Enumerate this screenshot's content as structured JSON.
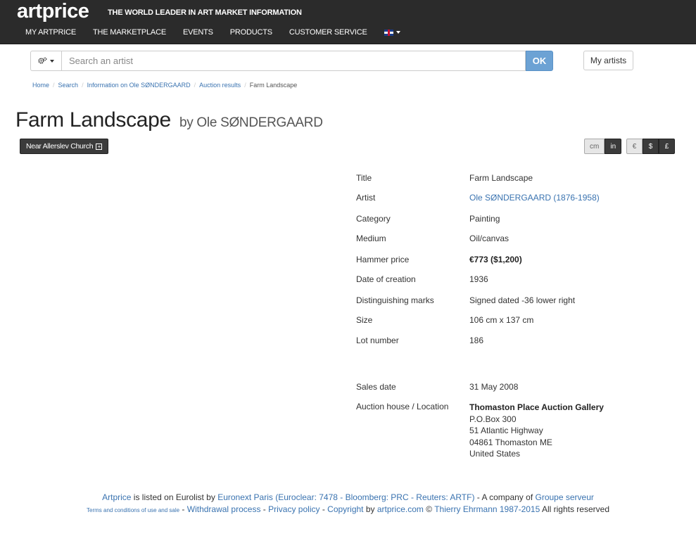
{
  "header": {
    "logo": "artprice",
    "logo_tm": "™",
    "tagline": "THE WORLD LEADER IN ART MARKET INFORMATION",
    "nav": [
      "MY ARTPRICE",
      "THE MARKETPLACE",
      "EVENTS",
      "PRODUCTS",
      "CUSTOMER SERVICE"
    ],
    "language_icon": "uk-flag-icon"
  },
  "search": {
    "placeholder": "Search an artist",
    "value": "",
    "ok_label": "OK",
    "settings_icon": "gears-icon",
    "my_artists_label": "My artists"
  },
  "breadcrumb": [
    "Home",
    "Search",
    "Information on Ole SØNDERGAARD",
    "Auction results",
    "Farm Landscape"
  ],
  "title": "Farm Landscape",
  "by_prefix": "by",
  "artist_name": "Ole SØNDERGAARD",
  "tag_button": "Near Allerslev Church",
  "units": [
    "cm",
    "in"
  ],
  "active_unit": "in",
  "currencies": [
    "€",
    "$",
    "£"
  ],
  "active_currency": "€",
  "details": {
    "title": {
      "label": "Title",
      "value": "Farm Landscape"
    },
    "artist": {
      "label": "Artist",
      "value": "Ole SØNDERGAARD (1876-1958)"
    },
    "category": {
      "label": "Category",
      "value": "Painting"
    },
    "medium": {
      "label": "Medium",
      "value": "Oil/canvas"
    },
    "hammer_price": {
      "label": "Hammer price",
      "value": "€773 ($1,200)"
    },
    "date_of_creation": {
      "label": "Date of creation",
      "value": "1936"
    },
    "marks": {
      "label": "Distinguishing marks",
      "value": "Signed dated -36 lower right"
    },
    "size": {
      "label": "Size",
      "value": "106 cm x 137 cm"
    },
    "lot": {
      "label": "Lot number",
      "value": "186"
    },
    "sales_date": {
      "label": "Sales date",
      "value": "31 May 2008"
    },
    "auction_house": {
      "label": "Auction house / Location",
      "name": "Thomaston Place Auction Gallery",
      "address": [
        "P.O.Box 300",
        "51 Atlantic Highway",
        "04861 Thomaston ME",
        "United States"
      ]
    }
  },
  "footer": {
    "artprice_link": "Artprice",
    "text1": " is listed on Eurolist by ",
    "euronext_link": "Euronext Paris (Euroclear: 7478 - Bloomberg: PRC - Reuters: ARTF)",
    "text2": " - A company of ",
    "groupe_link": "Groupe serveur",
    "terms_link": "Terms and conditions of use and sale",
    "dash1": " - ",
    "withdrawal_link": "Withdrawal process",
    "dash2": " - ",
    "privacy_link": "Privacy policy",
    "dash3": " - ",
    "copyright_link": "Copyright",
    "by_text": " by ",
    "artprice_com_link": "artprice.com",
    "copy_symbol": " © ",
    "ehrmann_link": "Thierry Ehrmann 1987-2015",
    "rights_text": " All rights reserved"
  }
}
